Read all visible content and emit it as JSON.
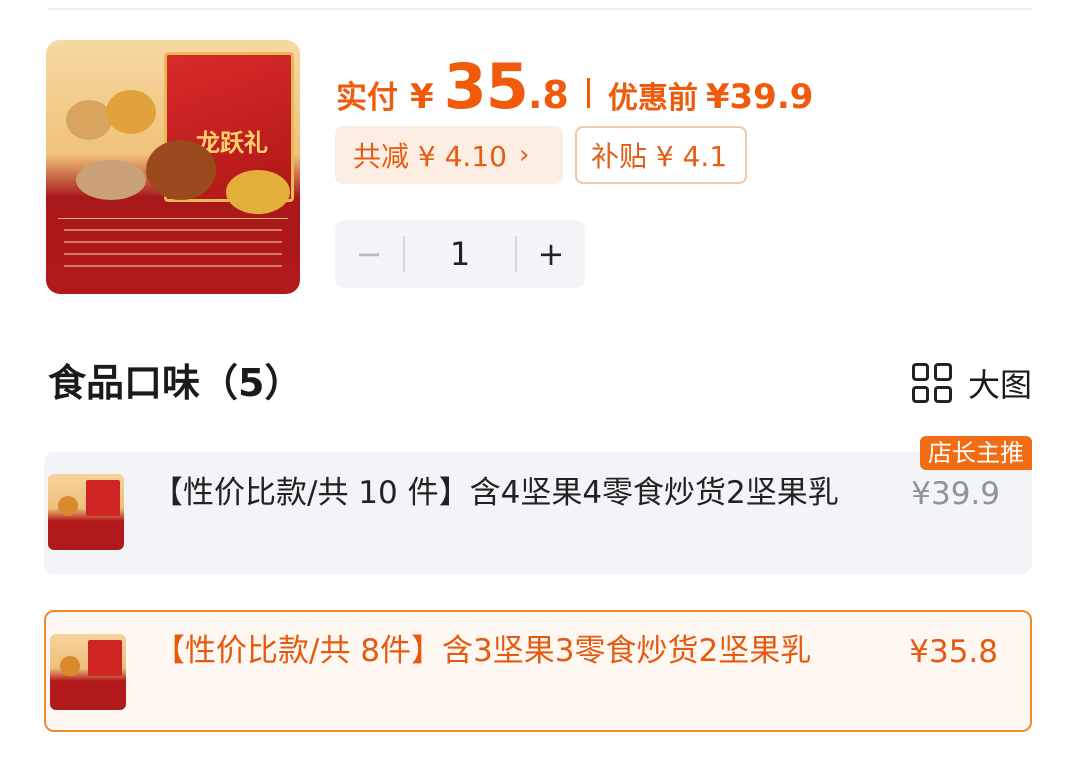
{
  "product": {
    "image_label": "龙跃礼"
  },
  "price": {
    "pay_label": "实付",
    "currency": "¥",
    "pay_int": "35",
    "pay_dec": ".8",
    "orig_label": "优惠前",
    "orig_price": "¥39.9"
  },
  "chips": {
    "reduce": "共减 ¥ 4.10",
    "reduce_chevron": "›",
    "subsidy": "补贴 ¥ 4.1"
  },
  "stepper": {
    "minus": "−",
    "value": "1",
    "plus": "+"
  },
  "section": {
    "title": "食品口味（5）",
    "view_label": "大图"
  },
  "options": [
    {
      "title": "【性价比款/共 10 件】含4坚果4零食炒货2坚果乳",
      "price": "¥39.9",
      "badge": "店长主推",
      "selected": false
    },
    {
      "title": "【性价比款/共 8件】含3坚果3零食炒货2坚果乳",
      "price": "¥35.8",
      "selected": true
    }
  ],
  "colors": {
    "accent": "#ef5a0b",
    "chip_bg": "#fdeee3",
    "selected_border": "#f08a2e",
    "option_bg": "#f2f4f8"
  }
}
